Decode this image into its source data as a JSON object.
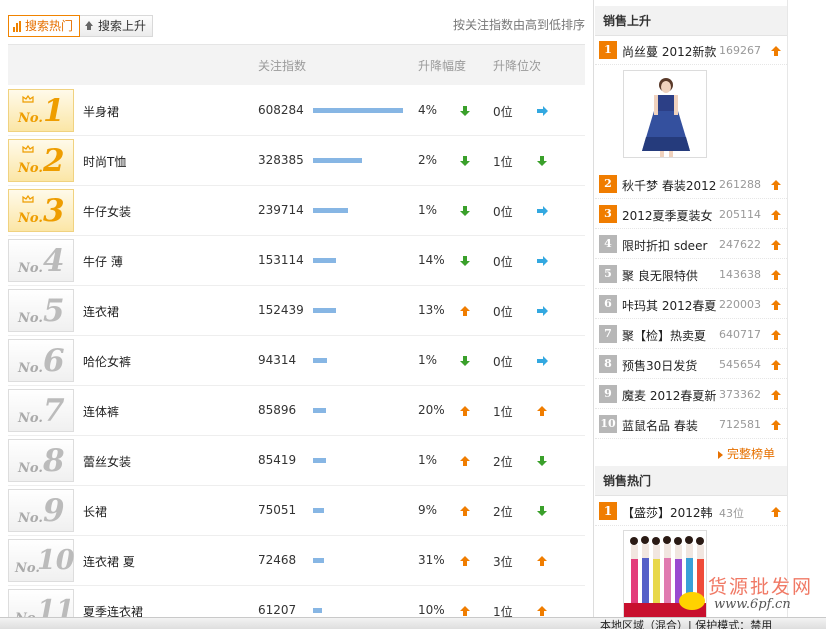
{
  "tabs": [
    {
      "label": "搜索热门",
      "active": true
    },
    {
      "label": "搜索上升",
      "active": false
    }
  ],
  "sort_note": "按关注指数由高到低排序",
  "columns": {
    "index": "关注指数",
    "change": "升降幅度",
    "rank_change": "升降位次"
  },
  "rows": [
    {
      "no": "No.",
      "rank": "1",
      "keyword": "半身裙",
      "index": "608284",
      "change": "4%",
      "change_dir": "down",
      "pos": "0位",
      "pos_dir": "flat",
      "level": 1.0
    },
    {
      "no": "No.",
      "rank": "2",
      "keyword": "时尚T恤",
      "index": "328385",
      "change": "2%",
      "change_dir": "down",
      "pos": "1位",
      "pos_dir": "down",
      "level": 0.54
    },
    {
      "no": "No.",
      "rank": "3",
      "keyword": "牛仔女装",
      "index": "239714",
      "change": "1%",
      "change_dir": "down",
      "pos": "0位",
      "pos_dir": "flat",
      "level": 0.39
    },
    {
      "no": "No.",
      "rank": "4",
      "keyword": "牛仔 薄",
      "index": "153114",
      "change": "14%",
      "change_dir": "down",
      "pos": "0位",
      "pos_dir": "flat",
      "level": 0.25
    },
    {
      "no": "No.",
      "rank": "5",
      "keyword": "连衣裙",
      "index": "152439",
      "change": "13%",
      "change_dir": "up",
      "pos": "0位",
      "pos_dir": "flat",
      "level": 0.25
    },
    {
      "no": "No.",
      "rank": "6",
      "keyword": "哈伦女裤",
      "index": "94314",
      "change": "1%",
      "change_dir": "down",
      "pos": "0位",
      "pos_dir": "flat",
      "level": 0.15
    },
    {
      "no": "No.",
      "rank": "7",
      "keyword": "连体裤",
      "index": "85896",
      "change": "20%",
      "change_dir": "up",
      "pos": "1位",
      "pos_dir": "up",
      "level": 0.14
    },
    {
      "no": "No.",
      "rank": "8",
      "keyword": "蕾丝女装",
      "index": "85419",
      "change": "1%",
      "change_dir": "up",
      "pos": "2位",
      "pos_dir": "down",
      "level": 0.14
    },
    {
      "no": "No.",
      "rank": "9",
      "keyword": "长裙",
      "index": "75051",
      "change": "9%",
      "change_dir": "up",
      "pos": "2位",
      "pos_dir": "down",
      "level": 0.12
    },
    {
      "no": "No.",
      "rank": "10",
      "keyword": "连衣裙 夏",
      "index": "72468",
      "change": "31%",
      "change_dir": "up",
      "pos": "3位",
      "pos_dir": "up",
      "level": 0.12
    },
    {
      "no": "No.",
      "rank": "11",
      "keyword": "夏季连衣裙",
      "index": "61207",
      "change": "10%",
      "change_dir": "up",
      "pos": "1位",
      "pos_dir": "up",
      "level": 0.1
    }
  ],
  "sales_rising": {
    "title": "销售上升",
    "items": [
      {
        "rank": "1",
        "name": "尚丝蔓 2012新款",
        "value": "169267",
        "dir": "up"
      },
      {
        "rank": "2",
        "name": "秋千梦 春装2012",
        "value": "261288",
        "dir": "up"
      },
      {
        "rank": "3",
        "name": "2012夏季夏装女",
        "value": "205114",
        "dir": "up"
      },
      {
        "rank": "4",
        "name": "限时折扣 sdeer",
        "value": "247622",
        "dir": "up"
      },
      {
        "rank": "5",
        "name": "聚 良无限特供",
        "value": "143638",
        "dir": "up"
      },
      {
        "rank": "6",
        "name": "咔玛其 2012春夏",
        "value": "220003",
        "dir": "up"
      },
      {
        "rank": "7",
        "name": "聚【检】热卖夏",
        "value": "640717",
        "dir": "up"
      },
      {
        "rank": "8",
        "name": "预售30日发货",
        "value": "545654",
        "dir": "up"
      },
      {
        "rank": "9",
        "name": "魔麦 2012春夏新",
        "value": "373362",
        "dir": "up"
      },
      {
        "rank": "10",
        "name": "蓝鼠名品 春装",
        "value": "712581",
        "dir": "up"
      }
    ],
    "more": "完整榜单"
  },
  "sales_hot": {
    "title": "销售热门",
    "items": [
      {
        "rank": "1",
        "name": "【盛莎】2012韩",
        "value": "43位",
        "dir": "up"
      }
    ]
  },
  "watermark": {
    "title": "货源批发网",
    "url": "www.6pf.cn"
  },
  "status_text": "本地区域（混合）| 保护模式：禁用",
  "colors": {
    "accent": "#f08300",
    "bar": "#87b6e4",
    "up": "#f07d00",
    "down": "#3aa02b",
    "flat": "#33a8e0"
  }
}
